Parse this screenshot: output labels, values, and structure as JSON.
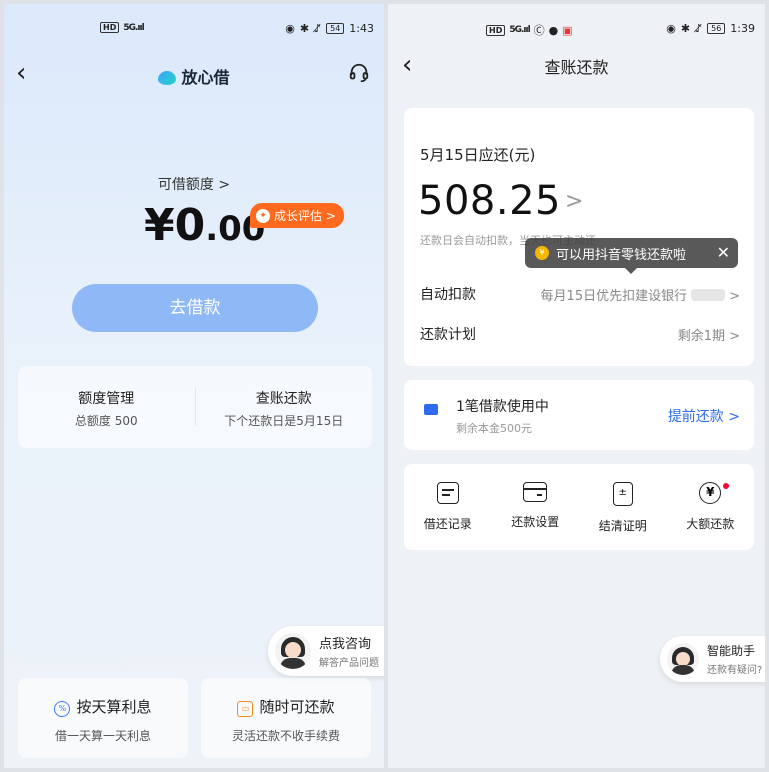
{
  "left": {
    "status": {
      "hd": "HD",
      "signal": "5G.ııl",
      "battery": "54",
      "time": "1:43"
    },
    "brand": "放心借",
    "limit_label": "可借额度 >",
    "amount_big": "¥0",
    "amount_small": ".00",
    "growth_badge": "成长评估 >",
    "borrow_button": "去借款",
    "quota": {
      "title": "额度管理",
      "sub": "总额度 500"
    },
    "repay": {
      "title": "查账还款",
      "sub": "下个还款日是5月15日"
    },
    "consult": {
      "title": "点我咨询",
      "sub": "解答产品问题"
    },
    "feature1": {
      "title": "按天算利息",
      "sub": "借一天算一天利息"
    },
    "feature2": {
      "title": "随时可还款",
      "sub": "灵活还款不收手续费"
    }
  },
  "right": {
    "status": {
      "hd": "HD",
      "signal": "5G.ııl",
      "battery": "56",
      "time": "1:39"
    },
    "title": "查账还款",
    "due_label": "5月15日应还(元)",
    "due_amount": "508.25",
    "due_note": "还款日会自动扣款，当天也可主动还",
    "tooltip": "可以用抖音零钱还款啦",
    "auto_debit": {
      "label": "自动扣款",
      "value": "每月15日优先扣建设银行"
    },
    "plan": {
      "label": "还款计划",
      "value": "剩余1期 >"
    },
    "loan": {
      "title": "1笔借款使用中",
      "sub": "剩余本金500元",
      "action": "提前还款 >"
    },
    "tools": [
      {
        "label": "借还记录",
        "icon": "record-icon"
      },
      {
        "label": "还款设置",
        "icon": "card-settings-icon"
      },
      {
        "label": "结清证明",
        "icon": "certificate-icon"
      },
      {
        "label": "大额还款",
        "icon": "yuan-icon"
      }
    ],
    "assistant": {
      "title": "智能助手",
      "sub": "还款有疑问?"
    }
  }
}
